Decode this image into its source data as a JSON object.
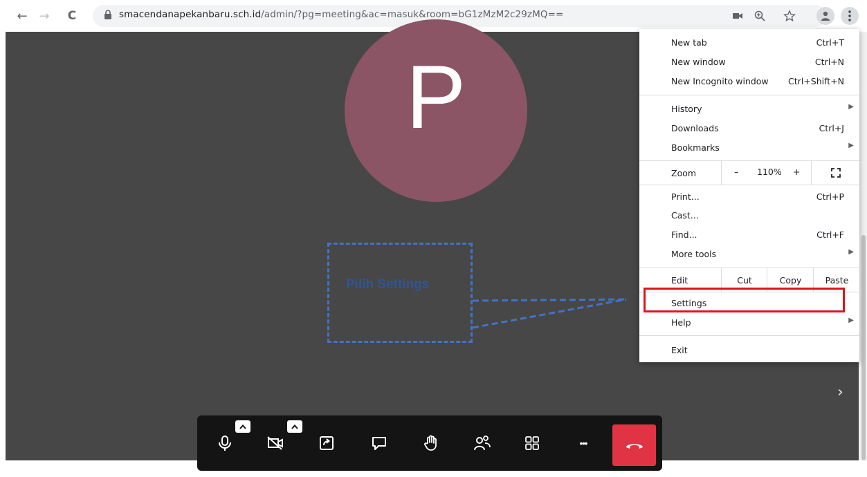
{
  "browser": {
    "url_host": "smacendanapekanbaru.sch.id",
    "url_path": "/admin/?pg=meeting&ac=masuk&room=bG1zMzM2c29zMQ==",
    "back_glyph": "←",
    "forward_glyph": "→",
    "reload_glyph": "C"
  },
  "meeting": {
    "participant_initial": "P",
    "avatar_color": "#8b5565",
    "side_panel_chevron": "›"
  },
  "annotation": {
    "callout_text": "Pilih Settings",
    "color": "#4472c4"
  },
  "chrome_menu": {
    "new_tab": "New tab",
    "new_tab_shortcut": "Ctrl+T",
    "new_window": "New window",
    "new_window_shortcut": "Ctrl+N",
    "new_incognito": "New Incognito window",
    "new_incognito_shortcut": "Ctrl+Shift+N",
    "history": "History",
    "downloads": "Downloads",
    "downloads_shortcut": "Ctrl+J",
    "bookmarks": "Bookmarks",
    "zoom_label": "Zoom",
    "zoom_minus": "–",
    "zoom_value": "110%",
    "zoom_plus": "+",
    "print": "Print...",
    "print_shortcut": "Ctrl+P",
    "cast": "Cast...",
    "find": "Find...",
    "find_shortcut": "Ctrl+F",
    "more_tools": "More tools",
    "edit": "Edit",
    "cut": "Cut",
    "copy": "Copy",
    "paste": "Paste",
    "settings": "Settings",
    "help": "Help",
    "exit": "Exit",
    "submenu_arrow": "▶"
  },
  "toolbar": {
    "caret": "^",
    "more_glyph": "•••",
    "end_call_color": "#e03344"
  },
  "highlight_color": "#e0121b"
}
